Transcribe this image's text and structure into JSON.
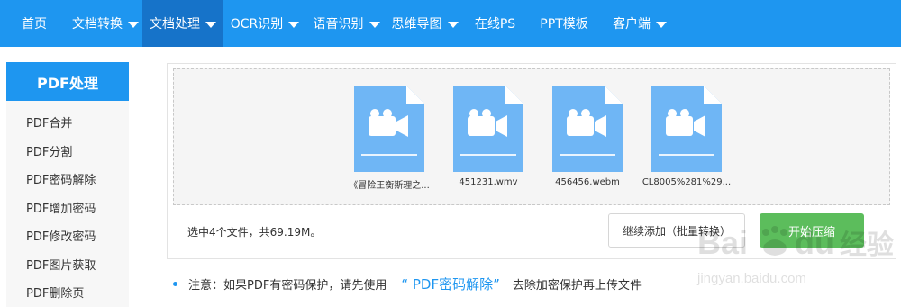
{
  "nav": {
    "items": [
      {
        "label": "首页",
        "dropdown": false
      },
      {
        "label": "文档转换",
        "dropdown": true
      },
      {
        "label": "文档处理",
        "dropdown": true,
        "active": true
      },
      {
        "label": "OCR识别",
        "dropdown": true
      },
      {
        "label": "语音识别",
        "dropdown": true
      },
      {
        "label": "思维导图",
        "dropdown": true
      },
      {
        "label": "在线PS",
        "dropdown": false
      },
      {
        "label": "PPT模板",
        "dropdown": false
      },
      {
        "label": "客户端",
        "dropdown": true
      }
    ]
  },
  "sidebar": {
    "title": "PDF处理",
    "items": [
      "PDF合并",
      "PDF分割",
      "PDF密码解除",
      "PDF增加密码",
      "PDF修改密码",
      "PDF图片获取",
      "PDF删除页"
    ]
  },
  "files": [
    {
      "name": "《冒险王衡斯理之...",
      "icon": "video-file-icon"
    },
    {
      "name": "451231.wmv",
      "icon": "video-file-icon"
    },
    {
      "name": "456456.webm",
      "icon": "video-file-icon"
    },
    {
      "name": "CL8005%281%29...",
      "icon": "video-file-icon"
    }
  ],
  "summary": "选中4个文件，共69.19M。",
  "buttons": {
    "add": "继续添加（批量转换）",
    "start": "开始压缩"
  },
  "notice": {
    "prefix": "注意：如果PDF有密码保护，请先使用",
    "link": "“ PDF密码解除”",
    "suffix": "去除加密保护再上传文件"
  },
  "watermark": {
    "brand": "Bai du 经验",
    "url": "jingyan.baidu.com"
  },
  "colors": {
    "primary": "#1e96f0",
    "nav_active": "#1673c9",
    "file_icon": "#6fb6f5",
    "start_button": "#5cbd5c"
  }
}
